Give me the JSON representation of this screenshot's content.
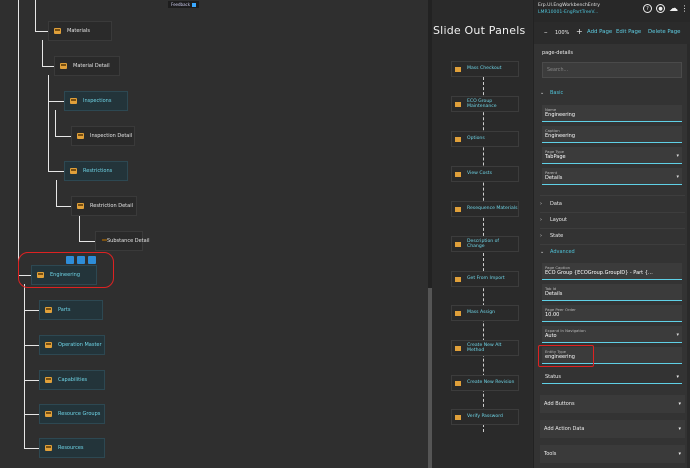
{
  "feedback": {
    "label": "Feedback"
  },
  "tree": {
    "nodes": [
      {
        "label": "Materials"
      },
      {
        "label": "Material Detail"
      },
      {
        "label": "Inspections"
      },
      {
        "label": "Inspection Detail"
      },
      {
        "label": "Restrictions"
      },
      {
        "label": "Restriction Detail"
      },
      {
        "label": "Substance Detail"
      },
      {
        "label": "Engineering"
      },
      {
        "label": "Parts"
      },
      {
        "label": "Operation Master"
      },
      {
        "label": "Capabilities"
      },
      {
        "label": "Resource Groups"
      },
      {
        "label": "Resources"
      }
    ]
  },
  "slide": {
    "title": "Slide Out Panels",
    "items": [
      {
        "label": "Mass Checkout"
      },
      {
        "label": "ECO Group Maintenance"
      },
      {
        "label": "Options"
      },
      {
        "label": "View Costs"
      },
      {
        "label": "Resequence Materials"
      },
      {
        "label": "Description of Change"
      },
      {
        "label": "Get From Import"
      },
      {
        "label": "Mass Assign"
      },
      {
        "label": "Create New Alt Method"
      },
      {
        "label": "Create New Revision"
      },
      {
        "label": "Verify Password"
      }
    ]
  },
  "panel": {
    "app_title": "Erp.UI.EngWorkbenchEntry",
    "layer_name": "LMR10001-EngPartTreeV...",
    "icons": [
      "help-icon",
      "person-icon",
      "cloud-icon",
      "more-vertical-icon"
    ],
    "zoom": "100%",
    "buttons": {
      "add": "Add Page",
      "edit": "Edit Page",
      "delete": "Delete Page"
    },
    "section_title": "page-details",
    "search_placeholder": "Search...",
    "groups": {
      "basic": "Basic",
      "data": "Data",
      "layout": "Layout",
      "state": "State",
      "advanced": "Advanced"
    },
    "fields": {
      "name": {
        "label": "Name",
        "value": "Engineering"
      },
      "caption": {
        "label": "Caption",
        "value": "Engineering"
      },
      "page_type": {
        "label": "Page Type",
        "value": "TabPage"
      },
      "parent": {
        "label": "Parent",
        "value": "Details"
      },
      "page_caption": {
        "label": "Page Caption",
        "value": "ECO Group {ECOGroup.GroupID} - Part {…"
      },
      "tab_id": {
        "label": "Tab Id",
        "value": "Details"
      },
      "page_peer_order": {
        "label": "Page Peer Order",
        "value": "10.00"
      },
      "expand_in_navigation": {
        "label": "Expand In Navigation",
        "value": "Auto"
      },
      "entity_type": {
        "label": "Entity Type",
        "value": "engineering"
      }
    },
    "status_label": "Status",
    "collapsibles": {
      "add_buttons": "Add Buttons",
      "add_action_data": "Add Action Data",
      "tools": "Tools"
    }
  },
  "colors": {
    "accent": "#5fd0e6",
    "highlight": "#dd2222",
    "node_icon": "#e0a03a"
  }
}
